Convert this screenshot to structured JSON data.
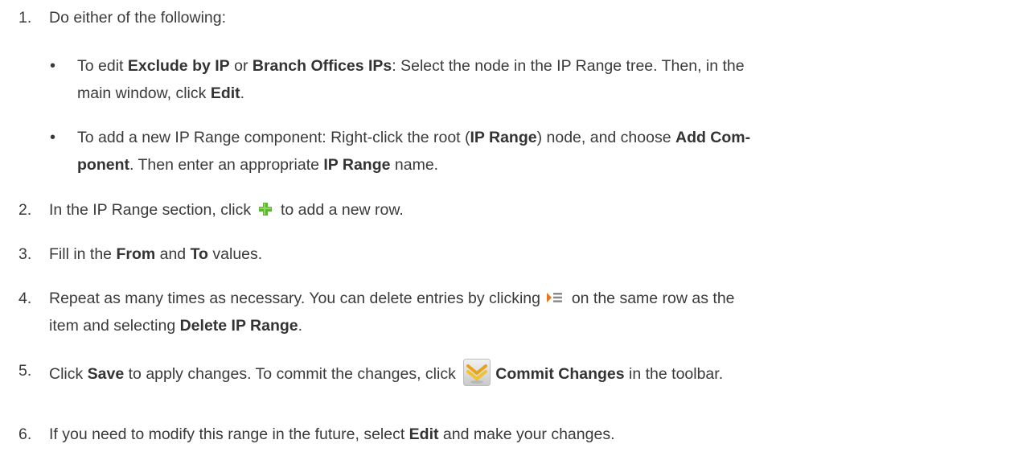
{
  "steps": [
    {
      "number": "1.",
      "text": "Do either of the following:"
    },
    {
      "number": "2.",
      "pre": "In the IP Range section, click",
      "icon": "green-plus-icon",
      "post": "to add a new row."
    },
    {
      "number": "3.",
      "pre": "Fill in the ",
      "b1": "From",
      "mid": " and ",
      "b2": "To",
      "post": " values."
    },
    {
      "number": "4.",
      "pre": "Repeat as many times as necessary. You can delete entries by clicking",
      "icon": "row-actions-menu-icon",
      "post": "on the same row as the",
      "line2_pre": "item and selecting ",
      "line2_bold": "Delete IP Range",
      "line2_post": "."
    },
    {
      "number": "5.",
      "pre": "Click ",
      "b1": "Save",
      "mid": " to apply changes. To commit the changes, click",
      "icon": "commit-changes-icon",
      "b2": "Commit Changes",
      "post": " in the toolbar."
    },
    {
      "number": "6.",
      "pre": "If you need to modify this range in the future, select ",
      "b1": "Edit",
      "post": " and make your changes."
    }
  ],
  "bullets": [
    {
      "symbol": "•",
      "l1_a": "To edit ",
      "l1_b": "Exclude by IP",
      "l1_c": " or ",
      "l1_d": "Branch Offices IPs",
      "l1_e": ": Select the node in the IP Range tree. Then, in the",
      "l2_a": "main window, click ",
      "l2_b": "Edit",
      "l2_c": "."
    },
    {
      "symbol": "•",
      "l1_a": "To add a new IP Range component: Right-click the root (",
      "l1_b": "IP Range",
      "l1_c": ") node, and choose ",
      "l1_d": "Add Com-",
      "l2_a": "ponent",
      "l2_b": ". Then enter an appropriate ",
      "l2_c": "IP Range",
      "l2_d": " name."
    }
  ],
  "colors": {
    "text": "#3a3a3a",
    "plus_green": "#5cb82e",
    "menu_orange": "#e8761c"
  }
}
